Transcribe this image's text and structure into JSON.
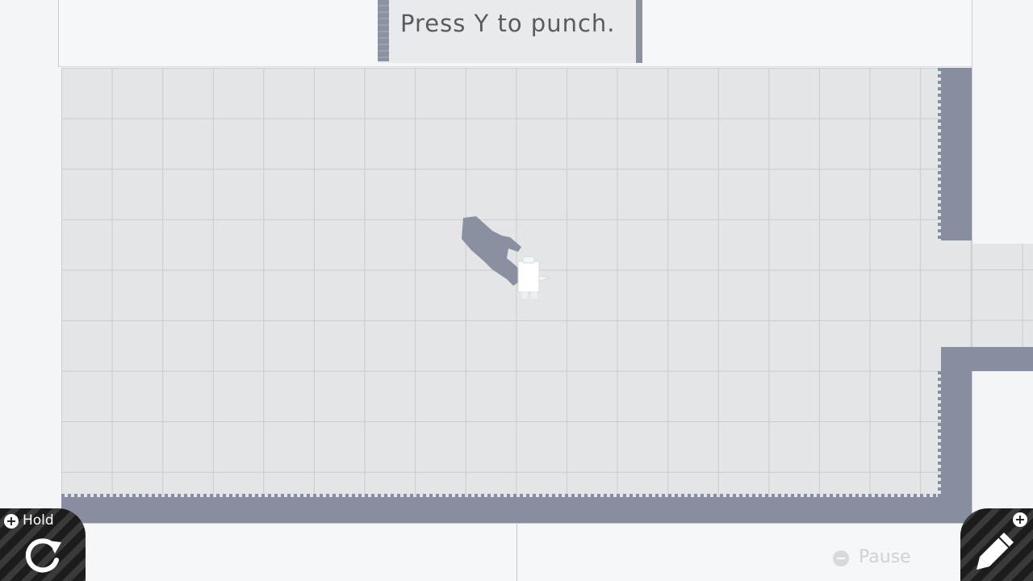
{
  "message": {
    "text": "Press Y to punch."
  },
  "controls": {
    "hold": {
      "plus": "+",
      "label": "Hold",
      "icon": "rotate-icon"
    },
    "edit": {
      "plus": "+",
      "icon": "pencil-icon"
    },
    "pause": {
      "icon": "minus-icon",
      "label": "Pause"
    }
  },
  "colors": {
    "floor": "#e4e5e7",
    "grid_line": "#c8cbd0",
    "wall_shadow": "#878ea0",
    "button_dark": "#1c1c1c",
    "text_gray": "#5b5b5b"
  }
}
